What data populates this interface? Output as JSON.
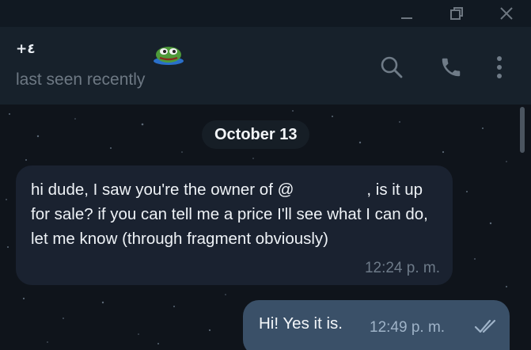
{
  "titlebar": {
    "minimize_icon": "minimize-icon",
    "restore_icon": "restore-icon",
    "close_icon": "close-icon"
  },
  "header": {
    "contact_name": "+٤",
    "status": "last seen recently",
    "avatar_icon": "frog-sticker-icon",
    "search_icon": "search-icon",
    "call_icon": "phone-icon",
    "menu_icon": "more-vertical-icon"
  },
  "chat": {
    "date_separator": "October 13",
    "messages": [
      {
        "direction": "incoming",
        "text_before_mention": "hi dude, I saw you're the owner of @",
        "text_after_mention": ", is it up for sale? if you can tell me a price I'll see what I can do, let me know (through fragment obviously)",
        "time": "12:24 p. m."
      },
      {
        "direction": "outgoing",
        "text": "Hi! Yes it is.",
        "time": "12:49 p. m.",
        "status_icon": "double-check-icon"
      }
    ]
  },
  "colors": {
    "header_bg": "#17212b",
    "incoming_bubble": "#1a2230",
    "outgoing_bubble": "#3a5068",
    "status_text": "#6d7883"
  }
}
